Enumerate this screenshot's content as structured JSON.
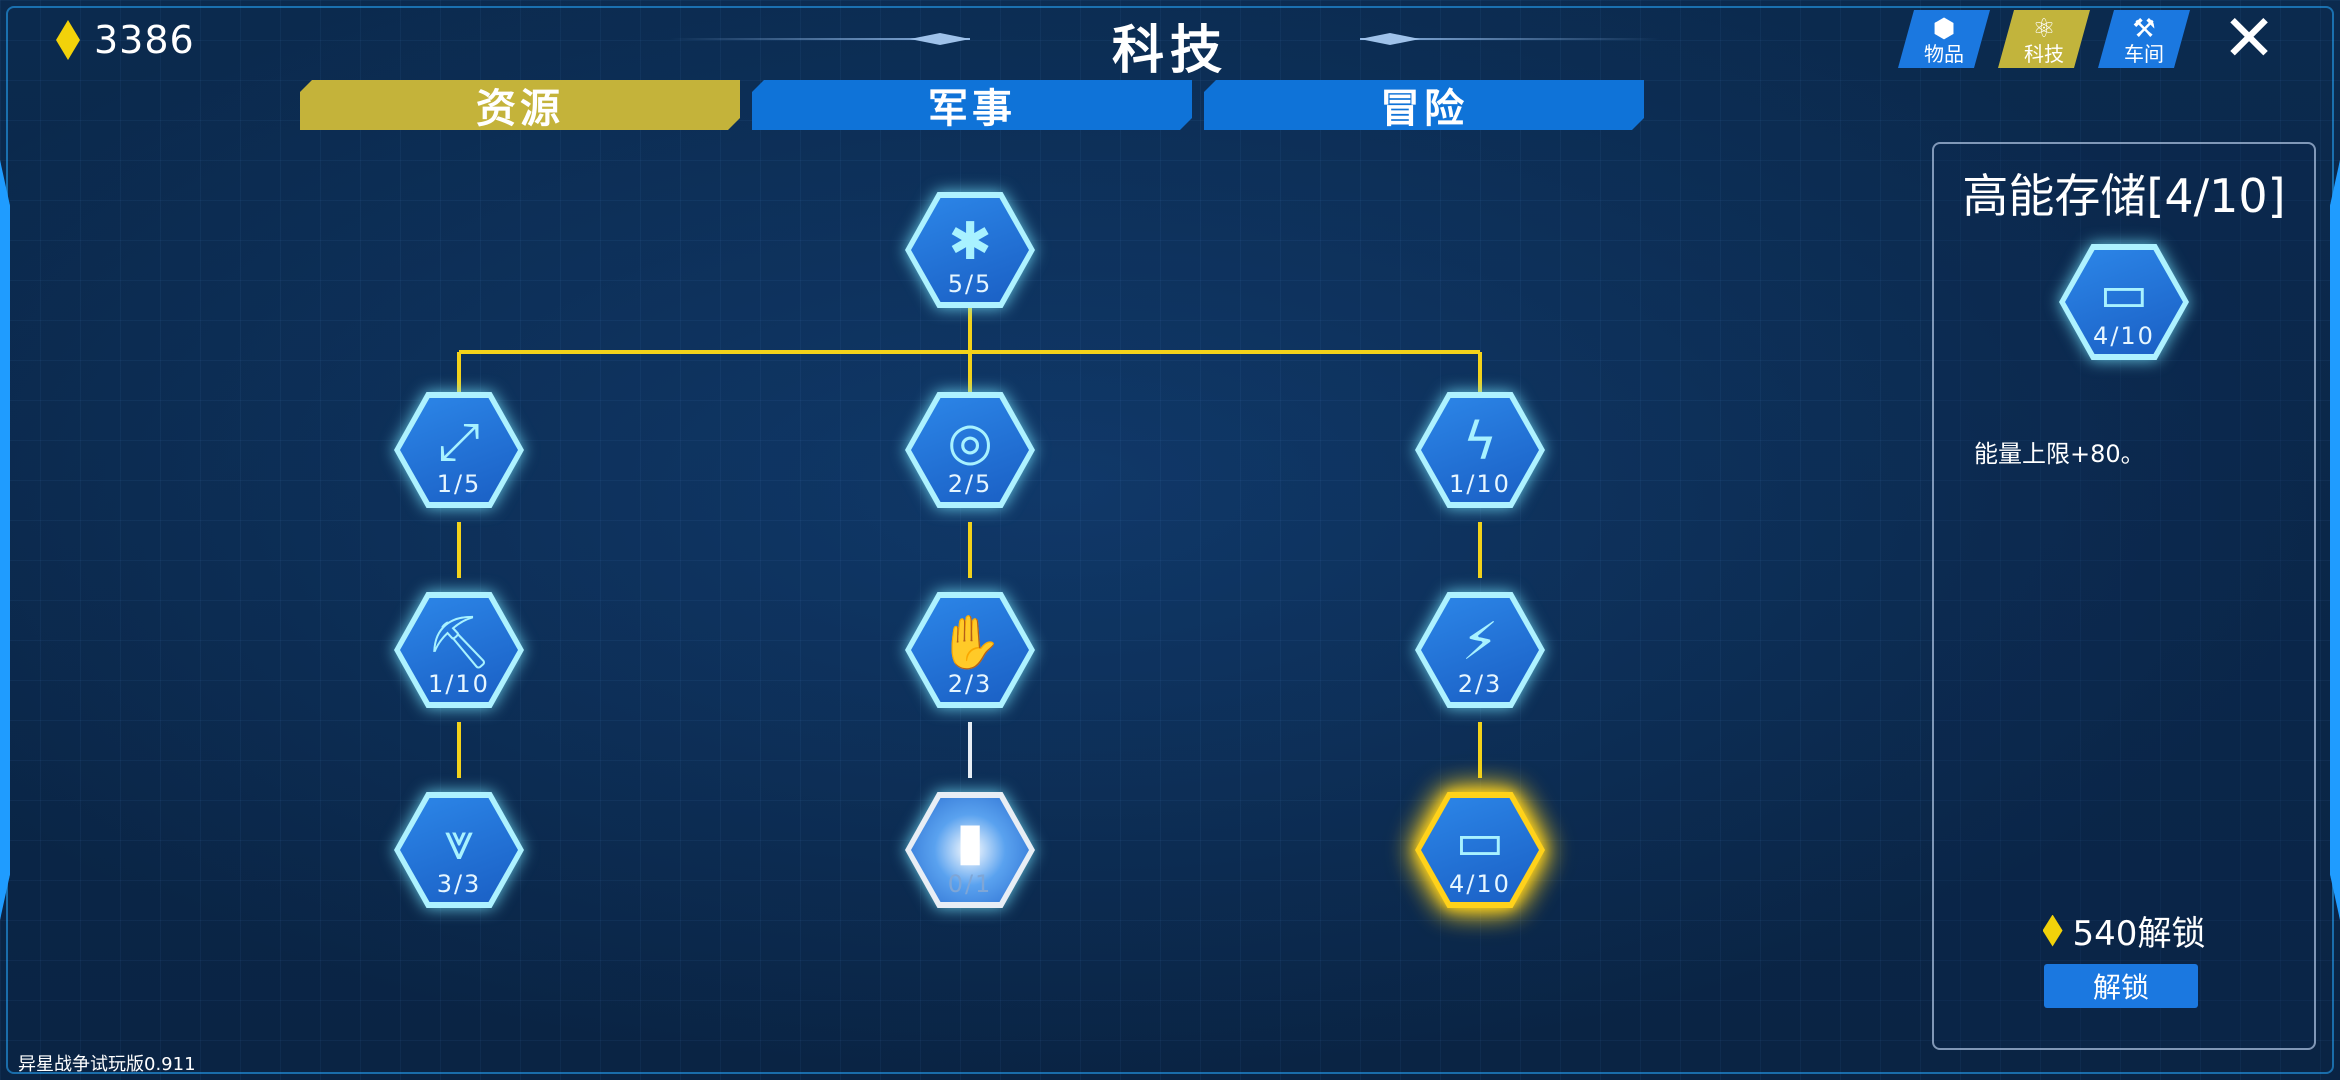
{
  "currency": {
    "amount": "3386",
    "icon": "diamond-icon",
    "color": "#f2d20a"
  },
  "title": "科技",
  "tabs": [
    {
      "label": "资源",
      "active": true
    },
    {
      "label": "军事",
      "active": false
    },
    {
      "label": "冒险",
      "active": false
    }
  ],
  "top_buttons": [
    {
      "label": "物品",
      "icon": "cube-icon",
      "active": false
    },
    {
      "label": "科技",
      "icon": "atom-icon",
      "active": true
    },
    {
      "label": "车间",
      "icon": "tools-icon",
      "active": false
    }
  ],
  "close_icon": "close-icon",
  "tree": {
    "nodes": [
      {
        "id": "root",
        "level": "5/5",
        "icon": "web-icon",
        "glyph": "✱"
      },
      {
        "id": "expand",
        "level": "1/5",
        "icon": "expand-arrows-icon",
        "glyph": "⤢"
      },
      {
        "id": "target",
        "level": "2/5",
        "icon": "target-icon",
        "glyph": "◎"
      },
      {
        "id": "lightning",
        "level": "1/10",
        "icon": "lightning-icon",
        "glyph": "ϟ"
      },
      {
        "id": "pickaxe",
        "level": "1/10",
        "icon": "pickaxe-icon",
        "glyph": "⛏"
      },
      {
        "id": "glove",
        "level": "2/3",
        "icon": "glove-icon",
        "glyph": "✋"
      },
      {
        "id": "charger",
        "level": "2/3",
        "icon": "charger-icon",
        "glyph": "⚡"
      },
      {
        "id": "drill",
        "level": "3/3",
        "icon": "drill-icon",
        "glyph": "⩔"
      },
      {
        "id": "locked",
        "level": "0/1",
        "icon": "locked-module-icon",
        "glyph": "▮"
      },
      {
        "id": "battery",
        "level": "4/10",
        "icon": "battery-icon",
        "glyph": "▭"
      }
    ]
  },
  "panel": {
    "title": "高能存储[4/10]",
    "node_level": "4/10",
    "node_icon": "battery-icon",
    "node_glyph": "▭",
    "description": "能量上限+80。",
    "cost": "540解锁",
    "unlock_label": "解锁"
  },
  "version": "异星战争试玩版0.911",
  "colors": {
    "accent_yellow": "#c4b33a",
    "accent_blue": "#0f73d8",
    "glow": "#aef2ff",
    "select": "#ffd21a"
  }
}
